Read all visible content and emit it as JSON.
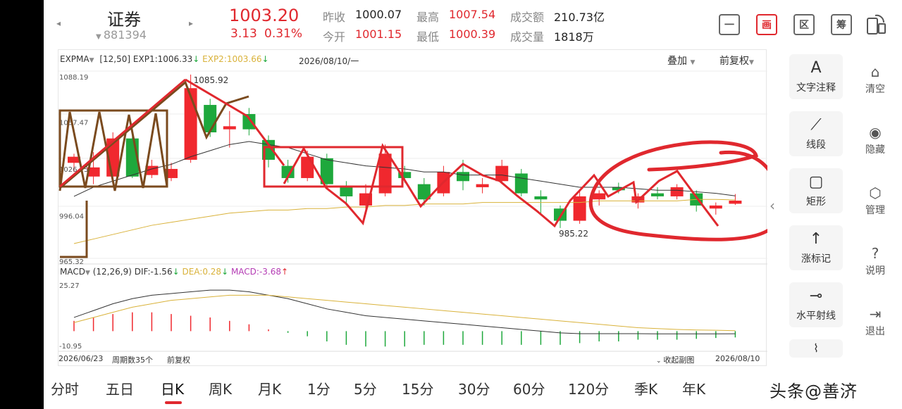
{
  "header": {
    "name": "证券",
    "code": "881394",
    "price": "1003.20",
    "change": "3.13",
    "change_pct": "0.31%",
    "quotes": {
      "prev_close_label": "昨收",
      "prev_close": "1000.07",
      "open_label": "今开",
      "open": "1001.15",
      "high_label": "最高",
      "high": "1007.54",
      "low_label": "最低",
      "low": "1000.39",
      "amount_label": "成交额",
      "amount": "210.73亿",
      "volume_label": "成交量",
      "volume": "1818万"
    },
    "buttons": [
      "一",
      "画",
      "区",
      "筹"
    ]
  },
  "main_legend": {
    "indicator": "EXPMA",
    "params": "[12,50]",
    "exp1": "EXP1:1006.33",
    "exp2": "EXP2:1003.66",
    "date": "2026/08/10/一",
    "overlay": "叠加",
    "adjust": "前复权"
  },
  "price_labels": {
    "top": "1088.19",
    "p1": "1057.47",
    "p2": "1026.75",
    "p3": "996.04",
    "bottom": "965.32",
    "high_mark": "1085.92",
    "low_mark": "985.22"
  },
  "macd_legend": {
    "indicator": "MACD",
    "params": "(12,26,9)",
    "dif": "DIF:-1.56",
    "dea": "DEA:0.28",
    "macd": "MACD:-3.68"
  },
  "macd_labels": {
    "top": "25.27",
    "bottom": "-10.95"
  },
  "footer": {
    "start_date": "2026/06/23",
    "period_count": "周期数35个",
    "adjust": "前复权",
    "collapse": "收起副图",
    "end_date": "2026/08/10"
  },
  "tools": [
    {
      "icon": "A",
      "label": "文字注释"
    },
    {
      "icon": "⟋",
      "label": "线段"
    },
    {
      "icon": "▢",
      "label": "矩形"
    },
    {
      "icon": "↑",
      "label": "涨标记"
    },
    {
      "icon": "⊸",
      "label": "水平射线"
    }
  ],
  "side_actions": [
    {
      "icon": "⌂",
      "label": "清空"
    },
    {
      "icon": "◉",
      "label": "隐藏"
    },
    {
      "icon": "⬡",
      "label": "管理"
    },
    {
      "icon": "?",
      "label": "说明"
    },
    {
      "icon": "⇥",
      "label": "退出"
    }
  ],
  "periods": [
    "分时",
    "五日",
    "日K",
    "周K",
    "月K",
    "1分",
    "5分",
    "15分",
    "30分",
    "60分",
    "120分",
    "季K",
    "年K"
  ],
  "active_period": "日K",
  "watermark": "头条@善济",
  "colors": {
    "up": "#f0282e",
    "down": "#1ea83c",
    "exp1": "#333333",
    "exp2": "#d9b23a",
    "annotation": "#e0282e",
    "drawing_brown": "#7a4a1e"
  },
  "chart_data": {
    "type": "candlestick",
    "price_range": [
      965.32,
      1088.19
    ],
    "candles": [
      {
        "o": 1028,
        "h": 1034,
        "l": 1022,
        "c": 1032
      },
      {
        "o": 1019,
        "h": 1035,
        "l": 1014,
        "c": 1025
      },
      {
        "o": 1019,
        "h": 1048,
        "l": 1016,
        "c": 1044
      },
      {
        "o": 1044,
        "h": 1048,
        "l": 1018,
        "c": 1019
      },
      {
        "o": 1020,
        "h": 1030,
        "l": 1018,
        "c": 1026
      },
      {
        "o": 1018,
        "h": 1028,
        "l": 1016,
        "c": 1024
      },
      {
        "o": 1030,
        "h": 1085.92,
        "l": 1028,
        "c": 1077
      },
      {
        "o": 1066,
        "h": 1070,
        "l": 1045,
        "c": 1048
      },
      {
        "o": 1050,
        "h": 1062,
        "l": 1038,
        "c": 1052
      },
      {
        "o": 1060,
        "h": 1064,
        "l": 1046,
        "c": 1050
      },
      {
        "o": 1043,
        "h": 1046,
        "l": 1025,
        "c": 1030
      },
      {
        "o": 1026,
        "h": 1030,
        "l": 1015,
        "c": 1018
      },
      {
        "o": 1018,
        "h": 1036,
        "l": 1016,
        "c": 1032
      },
      {
        "o": 1031,
        "h": 1034,
        "l": 1012,
        "c": 1014
      },
      {
        "o": 1012,
        "h": 1016,
        "l": 1000,
        "c": 1006
      },
      {
        "o": 1000,
        "h": 1014,
        "l": 998,
        "c": 1008
      },
      {
        "o": 1008,
        "h": 1040,
        "l": 1006,
        "c": 1034
      },
      {
        "o": 1022,
        "h": 1026,
        "l": 1015,
        "c": 1018
      },
      {
        "o": 1014,
        "h": 1018,
        "l": 1000,
        "c": 1004
      },
      {
        "o": 1008,
        "h": 1026,
        "l": 1006,
        "c": 1022
      },
      {
        "o": 1022,
        "h": 1030,
        "l": 1010,
        "c": 1016
      },
      {
        "o": 1012,
        "h": 1018,
        "l": 1008,
        "c": 1014
      },
      {
        "o": 1016,
        "h": 1030,
        "l": 1014,
        "c": 1026
      },
      {
        "o": 1021,
        "h": 1024,
        "l": 1006,
        "c": 1008
      },
      {
        "o": 1006,
        "h": 1010,
        "l": 994,
        "c": 1004
      },
      {
        "o": 998,
        "h": 1000,
        "l": 985.22,
        "c": 990
      },
      {
        "o": 990,
        "h": 1010,
        "l": 988,
        "c": 1006
      },
      {
        "o": 1004,
        "h": 1010,
        "l": 1000,
        "c": 1008
      },
      {
        "o": 1012,
        "h": 1015,
        "l": 1008,
        "c": 1010
      },
      {
        "o": 1002,
        "h": 1008,
        "l": 998,
        "c": 1006
      },
      {
        "o": 1008,
        "h": 1012,
        "l": 1004,
        "c": 1006
      },
      {
        "o": 1006,
        "h": 1014,
        "l": 1004,
        "c": 1012
      },
      {
        "o": 1008,
        "h": 1010,
        "l": 996,
        "c": 1000
      },
      {
        "o": 998,
        "h": 1002,
        "l": 994,
        "c": 1000
      },
      {
        "o": 1001.15,
        "h": 1007.54,
        "l": 1000.39,
        "c": 1003.2
      }
    ],
    "exp1": [
      1006,
      1012,
      1016,
      1020,
      1024,
      1027,
      1032,
      1036,
      1040,
      1042,
      1040,
      1038,
      1034,
      1030,
      1028,
      1026,
      1025,
      1024,
      1022,
      1022,
      1020,
      1020,
      1020,
      1018,
      1016,
      1014,
      1012,
      1012,
      1012,
      1011,
      1010,
      1010,
      1009,
      1008,
      1006.33
    ],
    "exp2": [
      975,
      978,
      981,
      984,
      987,
      989,
      991,
      993,
      995,
      996,
      997,
      997,
      998,
      998,
      999,
      999,
      1000,
      1000,
      1001,
      1001,
      1001,
      1002,
      1002,
      1002,
      1002,
      1002,
      1002,
      1003,
      1003,
      1003,
      1003,
      1003,
      1004,
      1004,
      1003.66
    ],
    "macd_range": [
      -10.95,
      25.27
    ],
    "dif": [
      8,
      12,
      16,
      19,
      21,
      22,
      23,
      24,
      24,
      23,
      21,
      19,
      16,
      13,
      11,
      9,
      8,
      7,
      6,
      5,
      4,
      3,
      2,
      1,
      0,
      -1,
      -1.5,
      -1.5,
      -1.5,
      -1.5,
      -1.6,
      -1.6,
      -1.6,
      -1.6,
      -1.56
    ],
    "dea": [
      5,
      8,
      11,
      14,
      16,
      18,
      19,
      20,
      21,
      21,
      21,
      20,
      19,
      18,
      17,
      16,
      15,
      14,
      13,
      12,
      11,
      10,
      9,
      8,
      7,
      6,
      5,
      4,
      3,
      2,
      1.5,
      1,
      0.7,
      0.5,
      0.28
    ],
    "macd": [
      6,
      8,
      10,
      11,
      11,
      10,
      9,
      8,
      6,
      4,
      1,
      -1,
      -3,
      -6,
      -8,
      -9,
      -9,
      -9,
      -8,
      -8,
      -8,
      -8,
      -8,
      -8,
      -8,
      -8,
      -7,
      -6,
      -6,
      -5,
      -5,
      -5,
      -4.5,
      -4,
      -3.68
    ]
  }
}
